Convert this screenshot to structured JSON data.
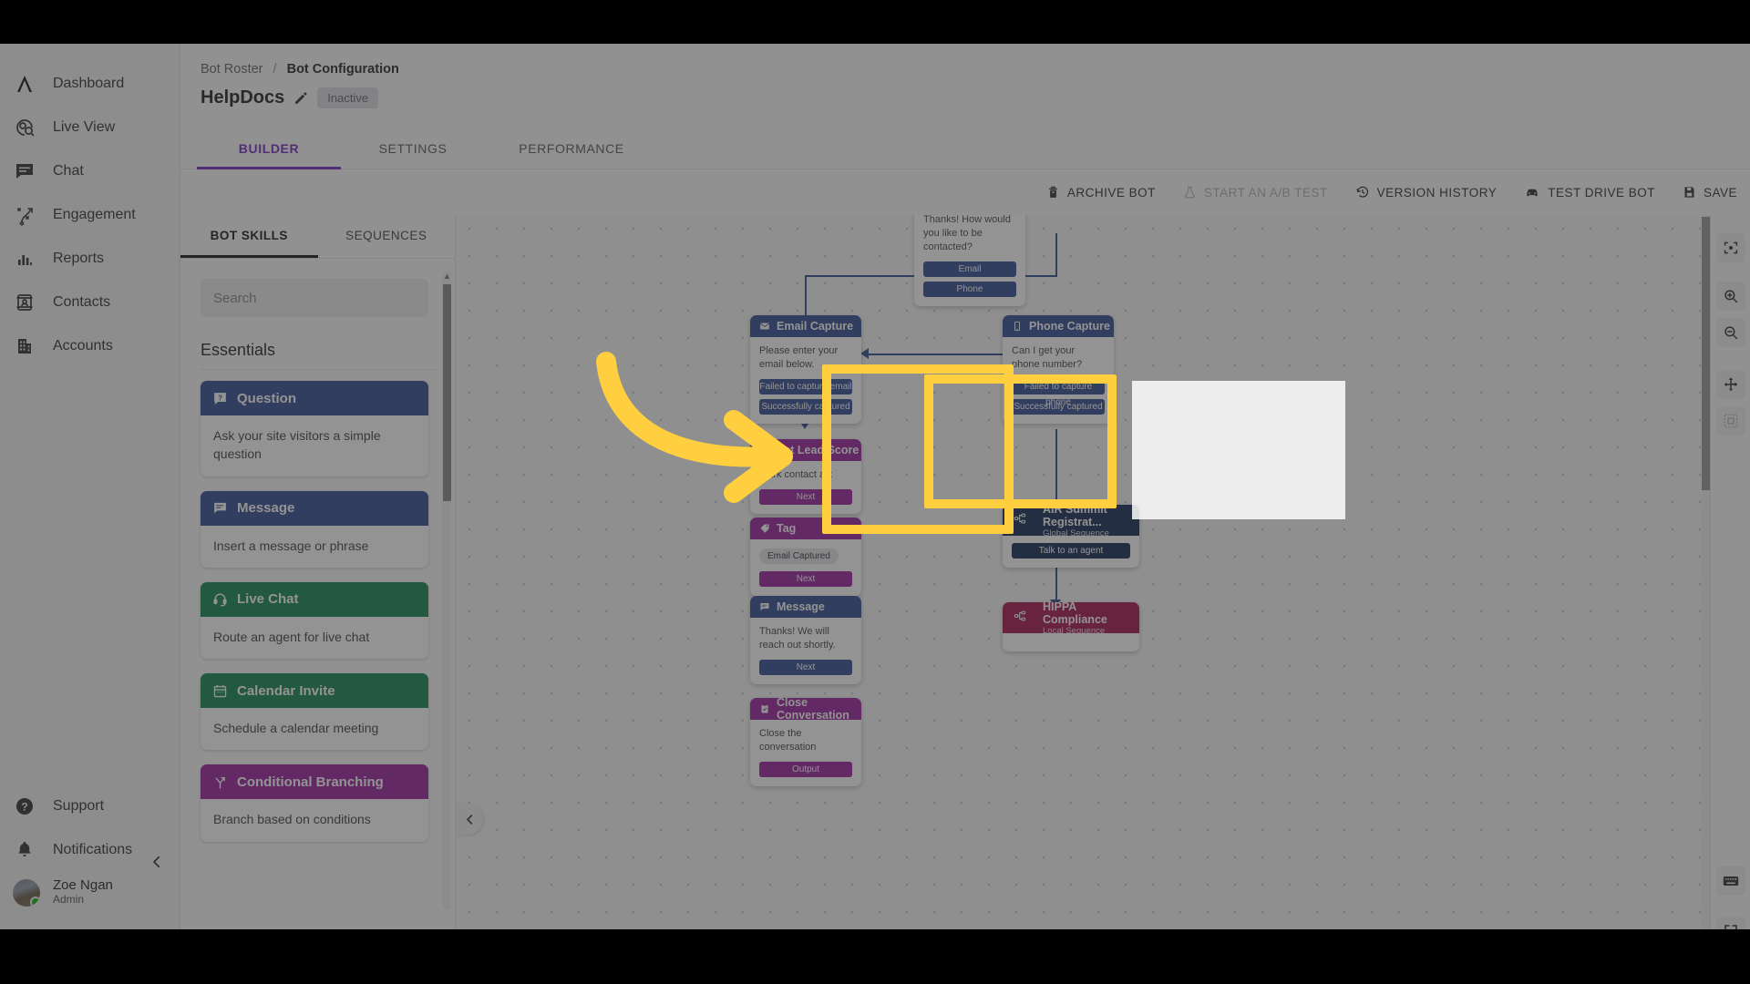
{
  "nav": {
    "top_items": [
      {
        "label": "Dashboard",
        "icon": "logo-caret-icon"
      },
      {
        "label": "Live View",
        "icon": "live-view-icon"
      },
      {
        "label": "Chat",
        "icon": "chat-bubble-icon"
      },
      {
        "label": "Engagement",
        "icon": "engagement-icon"
      },
      {
        "label": "Reports",
        "icon": "bar-chart-icon"
      },
      {
        "label": "Contacts",
        "icon": "contact-card-icon"
      },
      {
        "label": "Accounts",
        "icon": "building-icon"
      }
    ],
    "bottom_items": [
      {
        "label": "Support",
        "icon": "question-circle-icon"
      },
      {
        "label": "Notifications",
        "icon": "bell-icon"
      }
    ],
    "user": {
      "name": "Zoe Ngan",
      "role": "Admin",
      "status": "online"
    },
    "collapse_icon": "chevron-left-icon"
  },
  "header": {
    "breadcrumb_parent": "Bot Roster",
    "breadcrumb_sep": "/",
    "breadcrumb_current": "Bot Configuration",
    "bot_name": "HelpDocs",
    "edit_icon": "pencil-icon",
    "status_badge": "Inactive",
    "tabs": [
      {
        "label": "BUILDER",
        "active": true
      },
      {
        "label": "SETTINGS",
        "active": false
      },
      {
        "label": "PERFORMANCE",
        "active": false
      }
    ]
  },
  "toolbar": {
    "buttons": [
      {
        "label": "ARCHIVE BOT",
        "icon": "trash-icon",
        "disabled": false
      },
      {
        "label": "START AN A/B TEST",
        "icon": "flask-icon",
        "disabled": true
      },
      {
        "label": "VERSION HISTORY",
        "icon": "history-clock-icon",
        "disabled": false
      },
      {
        "label": "TEST DRIVE BOT",
        "icon": "car-icon",
        "disabled": false
      },
      {
        "label": "SAVE",
        "icon": "floppy-disk-icon",
        "disabled": false
      }
    ]
  },
  "skills_panel": {
    "tabs": [
      {
        "label": "BOT SKILLS",
        "active": true
      },
      {
        "label": "SEQUENCES",
        "active": false
      }
    ],
    "search_placeholder": "Search",
    "search_value": "",
    "group_title": "Essentials",
    "cards": [
      {
        "title": "Question",
        "desc": "Ask your site visitors a simple question",
        "color": "#3c5596",
        "icon": "question-box-icon"
      },
      {
        "title": "Message",
        "desc": "Insert a message or phrase",
        "color": "#3c5596",
        "icon": "message-icon"
      },
      {
        "title": "Live Chat",
        "desc": "Route an agent for live chat",
        "color": "#1f8a55",
        "icon": "headset-icon"
      },
      {
        "title": "Calendar Invite",
        "desc": "Schedule a calendar meeting",
        "color": "#1f8a55",
        "icon": "calendar-icon"
      },
      {
        "title": "Conditional Branching",
        "desc": "Branch based on conditions",
        "color": "#9c2aa0",
        "icon": "branch-icon"
      }
    ],
    "collapse_icon": "chevron-left-icon"
  },
  "canvas": {
    "nodes": [
      {
        "id": "contact-method",
        "kind": "plain",
        "text": "Thanks! How would you like to be contacted?",
        "buttons": [
          "Email",
          "Phone"
        ],
        "button_color": "#3c5596"
      },
      {
        "id": "email-capture",
        "kind": "headed",
        "title": "Email Capture",
        "icon": "envelope-icon",
        "head_color": "#3c5596",
        "text": "Please enter your email below.",
        "buttons": [
          "Failed to capture email",
          "Successfully captured email"
        ],
        "button_color": "#3c5596"
      },
      {
        "id": "phone-capture",
        "kind": "headed",
        "title": "Phone Capture",
        "icon": "phone-icon",
        "head_color": "#3c5596",
        "text": "Can I get your phone number?",
        "buttons": [
          "Failed to capture phone",
          "Successfully captured phone"
        ],
        "button_color": "#3c5596"
      },
      {
        "id": "set-lead-score",
        "kind": "headed",
        "title": "Set Lead Score",
        "icon": "star-icon",
        "head_color": "#9c2aa0",
        "text": "Mark contact as:",
        "buttons": [
          "Next"
        ],
        "button_color": "#9c2aa0"
      },
      {
        "id": "tag",
        "kind": "headed",
        "title": "Tag",
        "icon": "tag-icon",
        "head_color": "#9c2aa0",
        "chip": "Email Captured",
        "buttons": [
          "Next"
        ],
        "button_color": "#9c2aa0"
      },
      {
        "id": "message",
        "kind": "headed",
        "title": "Message",
        "icon": "message-icon",
        "head_color": "#3c5596",
        "text": "Thanks! We will reach out shortly.",
        "buttons": [
          "Next"
        ],
        "button_color": "#3c5596"
      },
      {
        "id": "close-conversation",
        "kind": "headed",
        "title": "Close Conversation",
        "icon": "clipboard-check-icon",
        "head_color": "#9c2aa0",
        "text": "Close the conversation",
        "buttons": [
          "Output"
        ],
        "button_color": "#9c2aa0"
      },
      {
        "id": "air-summit",
        "kind": "sequence",
        "title": "AIR Summit Registrat...",
        "subtitle": "Global Sequence",
        "icon": "sequence-icon",
        "head_color": "#21355e",
        "buttons": [
          "Talk to an agent"
        ],
        "button_color": "#21355e"
      },
      {
        "id": "hippa-compliance",
        "kind": "sequence",
        "title": "HIPPA Compliance",
        "subtitle": "Local Sequence",
        "icon": "sequence-icon",
        "head_color": "#a81e55",
        "buttons": [],
        "button_color": "#a81e55"
      }
    ],
    "tools": [
      {
        "icon": "focus-target-icon",
        "name": "center-view"
      },
      {
        "icon": "zoom-in-icon",
        "name": "zoom-in"
      },
      {
        "icon": "zoom-out-icon",
        "name": "zoom-out"
      },
      {
        "icon": "pan-move-icon",
        "name": "pan"
      },
      {
        "icon": "fit-selection-icon",
        "name": "fit-selection",
        "dim": true
      },
      {
        "icon": "keyboard-icon",
        "name": "keyboard-shortcuts"
      },
      {
        "icon": "fullscreen-icon",
        "name": "fullscreen"
      }
    ]
  },
  "annotation": {
    "highlight_color": "#ffcf40",
    "arrow_color": "#ffcf40",
    "arrow_icon": "curved-arrow-right-icon",
    "boxes": 2
  }
}
